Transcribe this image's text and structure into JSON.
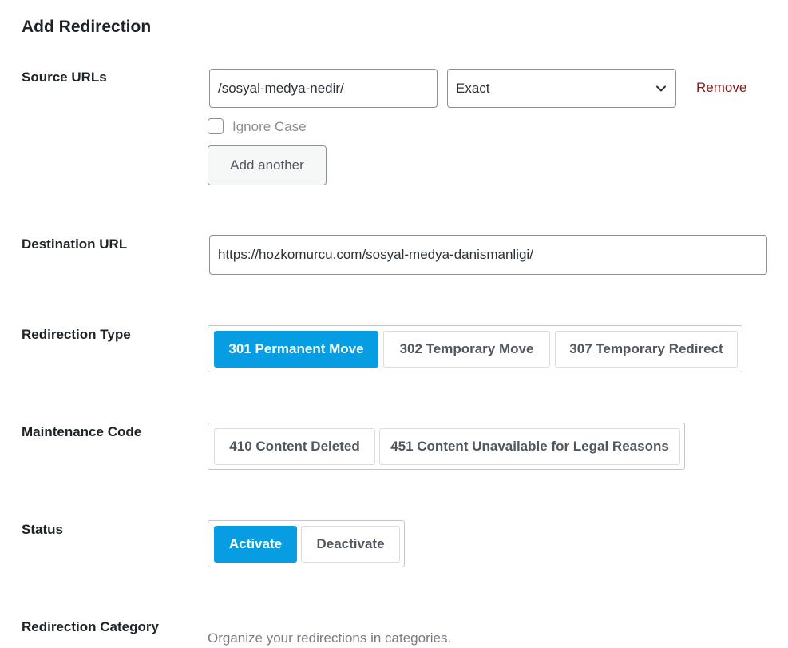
{
  "page": {
    "title": "Add Redirection"
  },
  "source_urls": {
    "label": "Source URLs",
    "url_value": "/sosyal-medya-nedir/",
    "match_type": "Exact",
    "remove_label": "Remove",
    "ignore_case_label": "Ignore Case",
    "ignore_case_checked": false,
    "add_another_label": "Add another"
  },
  "destination_url": {
    "label": "Destination URL",
    "value": "https://hozkomurcu.com/sosyal-medya-danismanligi/"
  },
  "redirection_type": {
    "label": "Redirection Type",
    "options": [
      {
        "label": "301 Permanent Move",
        "active": true
      },
      {
        "label": "302 Temporary Move",
        "active": false
      },
      {
        "label": "307 Temporary Redirect",
        "active": false
      }
    ]
  },
  "maintenance_code": {
    "label": "Maintenance Code",
    "options": [
      {
        "label": "410 Content Deleted",
        "active": false
      },
      {
        "label": "451 Content Unavailable for Legal Reasons",
        "active": false
      }
    ]
  },
  "status": {
    "label": "Status",
    "options": [
      {
        "label": "Activate",
        "active": true
      },
      {
        "label": "Deactivate",
        "active": false
      }
    ]
  },
  "redirection_category": {
    "label": "Redirection Category",
    "helper_text": "Organize your redirections in categories."
  },
  "colors": {
    "accent": "#069de3",
    "remove_link": "#8a1a1a",
    "border": "#8c8f94"
  },
  "icons": {
    "select_arrow": "chevron-down-icon"
  }
}
